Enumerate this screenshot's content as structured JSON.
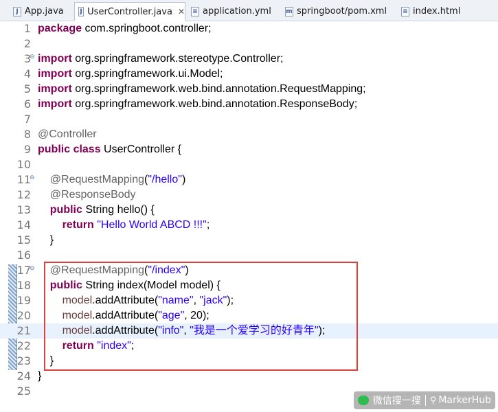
{
  "tabs": [
    {
      "label": "App.java",
      "icon": "java-file-icon",
      "active": false
    },
    {
      "label": "UserController.java",
      "icon": "java-file-icon",
      "active": true,
      "closable": true
    },
    {
      "label": "application.yml",
      "icon": "yml-file-icon",
      "active": false
    },
    {
      "label": "springboot/pom.xml",
      "icon": "maven-pom-icon",
      "active": false
    },
    {
      "label": "index.html",
      "icon": "html-file-icon",
      "active": false
    }
  ],
  "editor": {
    "line_numbers": [
      "1",
      "2",
      "3",
      "4",
      "5",
      "6",
      "7",
      "8",
      "9",
      "10",
      "11",
      "12",
      "13",
      "14",
      "15",
      "16",
      "17",
      "18",
      "19",
      "20",
      "21",
      "22",
      "23",
      "24",
      "25"
    ],
    "text": {
      "package_kw": "package",
      "package_name": " com.springboot.controller;",
      "import_kw": "import",
      "import_1": " org.springframework.stereotype.Controller;",
      "import_2": " org.springframework.ui.Model;",
      "import_3": " org.springframework.web.bind.annotation.RequestMapping;",
      "import_4": " org.springframework.web.bind.annotation.ResponseBody;",
      "ann_controller": "@Controller",
      "public_kw": "public",
      "class_kw": "class",
      "class_decl": " UserController {",
      "ann_request_mapping": "@RequestMapping",
      "open_paren": "(",
      "close_paren": ")",
      "str_hello_path": "\"/hello\"",
      "ann_response_body": "@ResponseBody",
      "hello_sig": " String hello() {",
      "return_kw": "return",
      "str_hello": "\"Hello World ABCD !!!\"",
      "semicolon": ";",
      "close_brace": "}",
      "str_index_path": "\"/index\"",
      "index_sig": " String index(Model model) {",
      "model": "model",
      "add_attr": ".addAttribute(",
      "str_name": "\"name\"",
      "str_jack": "\"jack\"",
      "str_age": "\"age\"",
      "age_rest": ", 20);",
      "str_info": "\"info\"",
      "str_info_value": "\"我是一个爱学习的好青年\"",
      "comma": ", ",
      "end_call": ");",
      "str_index": "\"index\""
    }
  },
  "watermark": {
    "wechat_label": "微信搜一搜",
    "search_icon": "search-icon",
    "brand": "MarkerHub"
  },
  "colors": {
    "keyword": "#7f0055",
    "string": "#2a00ff",
    "annotation": "#646464",
    "field": "#6a3e3e",
    "current_line": "#e8f2fe",
    "highlight_box": "#e0403a"
  }
}
